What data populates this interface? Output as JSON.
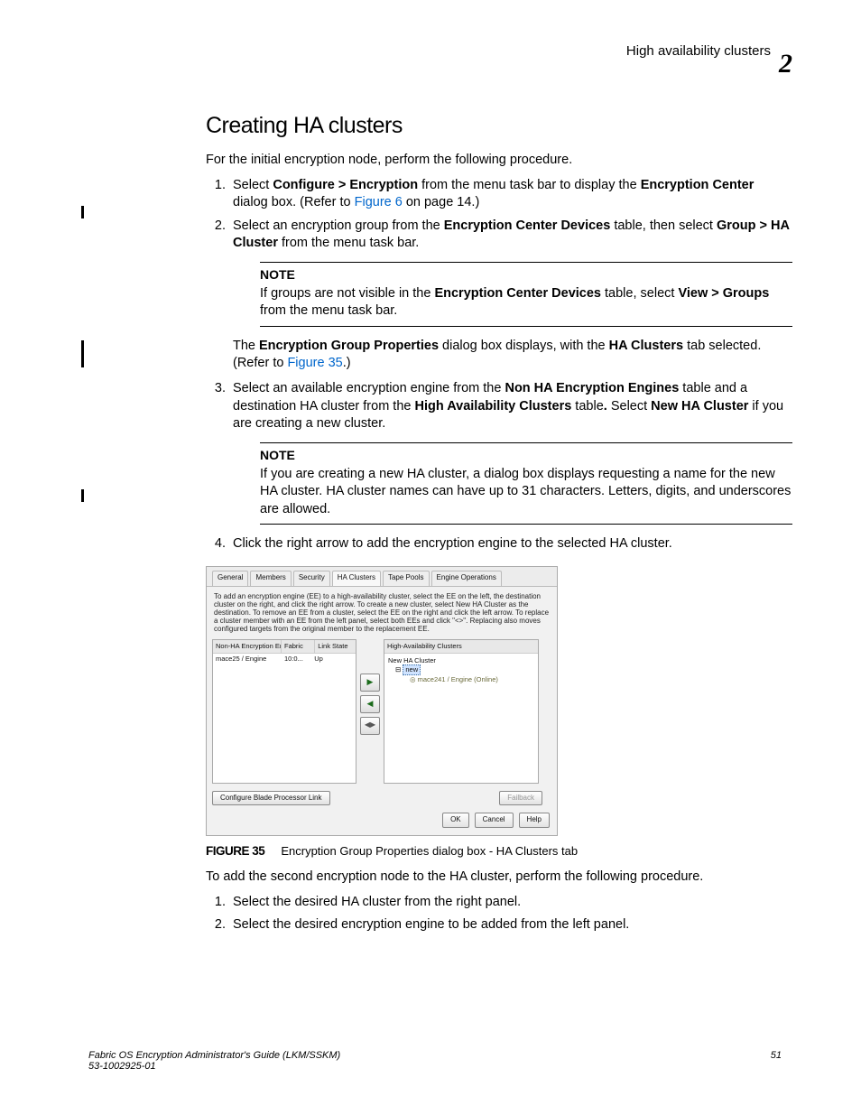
{
  "header": {
    "running_head": "High availability clusters",
    "chapter_number": "2"
  },
  "heading": "Creating HA clusters",
  "intro": "For the initial encryption node, perform the following procedure.",
  "steps_a": {
    "s1_a": "Select ",
    "s1_b": "Configure > Encryption",
    "s1_c": " from the menu task bar to display the ",
    "s1_d": "Encryption Center",
    "s1_e": " dialog box. (Refer to ",
    "s1_link": "Figure 6",
    "s1_f": " on page 14.)",
    "s2_a": "Select an encryption group from the ",
    "s2_b": "Encryption Center Devices",
    "s2_c": " table, then select ",
    "s2_d": "Group > HA Cluster",
    "s2_e": " from the menu task bar.",
    "s3_a": "Select an available encryption engine from the ",
    "s3_b": "Non HA Encryption Engines",
    "s3_c": " table and a destination HA cluster from the ",
    "s3_d": "High Availability Clusters",
    "s3_e": " table",
    "s3_f": ". ",
    "s3_g": "Select ",
    "s3_h": "New HA Cluster",
    "s3_i": " if you are creating a new cluster.",
    "s4": "Click the right arrow to add the encryption engine to the selected HA cluster."
  },
  "note1": {
    "title": "NOTE",
    "a": "If groups are not visible in the ",
    "b": "Encryption Center Devices",
    "c": " table, select ",
    "d": "View > Groups",
    "e": " from the menu task bar."
  },
  "mid_para": {
    "a": "The ",
    "b": "Encryption Group Properties",
    "c": " dialog box displays, with the ",
    "d": "HA Clusters",
    "e": " tab selected. (Refer to ",
    "link": "Figure 35",
    "f": ".)"
  },
  "note2": {
    "title": "NOTE",
    "text": "If you are creating a new HA cluster, a dialog box displays requesting a name for the new HA cluster. HA cluster names can have up to 31 characters. Letters, digits, and underscores are allowed."
  },
  "dialog": {
    "tabs": [
      "General",
      "Members",
      "Security",
      "HA Clusters",
      "Tape Pools",
      "Engine Operations"
    ],
    "selected_tab": "HA Clusters",
    "help_text": "To add an encryption engine (EE) to a high-availability cluster, select the EE on the left, the destination cluster on the right, and click the right arrow. To create a new cluster, select New HA Cluster as the destination. To remove an EE from a cluster, select the EE on the right and click the left arrow. To replace a cluster member with an EE from the left panel, select both EEs and click \"<>\". Replacing also moves configured targets from the original member to the replacement EE.",
    "left_headers": [
      "Non-HA Encryption Engines",
      "Fabric",
      "Link State"
    ],
    "left_row": {
      "engine": "mace25 / Engine",
      "fabric": "10:0...",
      "link": "Up"
    },
    "right_header": "High-Availability Clusters",
    "tree": {
      "root": "New HA Cluster",
      "sel": "new",
      "leaf": "mace241 / Engine (Online)"
    },
    "btn_left": "Configure Blade Processor Link",
    "btn_right": "Failback",
    "footer_buttons": [
      "OK",
      "Cancel",
      "Help"
    ]
  },
  "figure": {
    "num": "FIGURE 35",
    "caption": "Encryption Group Properties dialog box - HA Clusters tab"
  },
  "second_intro": "To add the second encryption node to the HA cluster, perform the following procedure.",
  "steps_b": {
    "s1": "Select the desired HA cluster from the right panel.",
    "s2": "Select the desired encryption engine to be added from the left panel."
  },
  "footer": {
    "left_line1": "Fabric OS Encryption Administrator's Guide  (LKM/SSKM)",
    "left_line2": "53-1002925-01",
    "page": "51"
  }
}
